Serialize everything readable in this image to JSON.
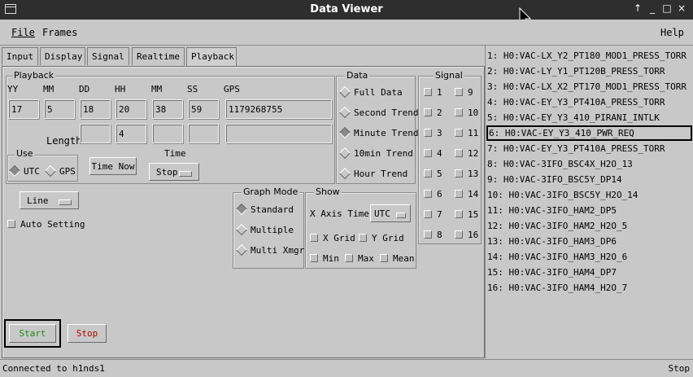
{
  "window": {
    "title": "Data Viewer",
    "controls": [
      "↑",
      "_",
      "□",
      "×"
    ]
  },
  "menu": {
    "file": "File",
    "frames": "Frames",
    "help": "Help"
  },
  "tabs": [
    "Input",
    "Display",
    "Signal",
    "Realtime",
    "Playback"
  ],
  "playback": {
    "group_label": "Playback",
    "headers": [
      "YY",
      "MM",
      "DD",
      "HH",
      "MM",
      "SS",
      "GPS"
    ],
    "start_values": [
      "17",
      "5",
      "18",
      "20",
      "38",
      "59",
      "1179268755"
    ],
    "length_label": "Length",
    "length_values": [
      "",
      "4",
      "",
      "",
      ""
    ],
    "use_label": "Use",
    "use_options": [
      "UTC",
      "GPS"
    ],
    "use_selected": "UTC",
    "time_now_label": "Time Now",
    "time_label": "Time",
    "time_option": "Stop"
  },
  "data_group": {
    "label": "Data",
    "options": [
      "Full Data",
      "Second Trend",
      "Minute Trend",
      "10min Trend",
      "Hour Trend"
    ],
    "selected": "Minute Trend"
  },
  "signal_group": {
    "label": "Signal",
    "items": [
      "1",
      "9",
      "2",
      "10",
      "3",
      "11",
      "4",
      "12",
      "5",
      "13",
      "6",
      "14",
      "7",
      "15",
      "8",
      "16"
    ]
  },
  "line_option": "Line",
  "auto_setting": "Auto Setting",
  "graph_mode": {
    "label": "Graph Mode",
    "options": [
      "Standard",
      "Multiple",
      "Multi Xmgr"
    ],
    "selected": "Standard"
  },
  "show": {
    "label": "Show",
    "x_axis_time": "X Axis Time",
    "x_axis_value": "UTC",
    "x_grid": "X Grid",
    "y_grid": "Y Grid",
    "min": "Min",
    "max": "Max",
    "mean": "Mean"
  },
  "buttons": {
    "start": "Start",
    "stop": "Stop"
  },
  "channels": [
    "1: H0:VAC-LX_Y2_PT180_MOD1_PRESS_TORR",
    "2: H0:VAC-LY_Y1_PT120B_PRESS_TORR",
    "3: H0:VAC-LX_X2_PT170_MOD1_PRESS_TORR",
    "4: H0:VAC-EY_Y3_PT410A_PRESS_TORR",
    "5: H0:VAC-EY_Y3_410_PIRANI_INTLK",
    "6: H0:VAC-EY_Y3_410_PWR_REQ",
    "7: H0:VAC-EY_Y3_PT410A_PRESS_TORR",
    "8: H0:VAC-3IFO_BSC4X_H2O_13",
    "9: H0:VAC-3IFO_BSC5Y_DP14",
    "10: H0:VAC-3IFO_BSC5Y_H2O_14",
    "11: H0:VAC-3IFO_HAM2_DP5",
    "12: H0:VAC-3IFO_HAM2_H2O_5",
    "13: H0:VAC-3IFO_HAM3_DP6",
    "14: H0:VAC-3IFO_HAM3_H2O_6",
    "15: H0:VAC-3IFO_HAM4_DP7",
    "16: H0:VAC-3IFO_HAM4_H2O_7"
  ],
  "selected_channel_index": 5,
  "status": {
    "left": "Connected to h1nds1",
    "right": "Stop"
  },
  "colors": {
    "titlebar": "#2e2e2e",
    "start_text": "#1a8a1a",
    "stop_text": "#b00000",
    "panel_bg": "#c8c8c8"
  }
}
